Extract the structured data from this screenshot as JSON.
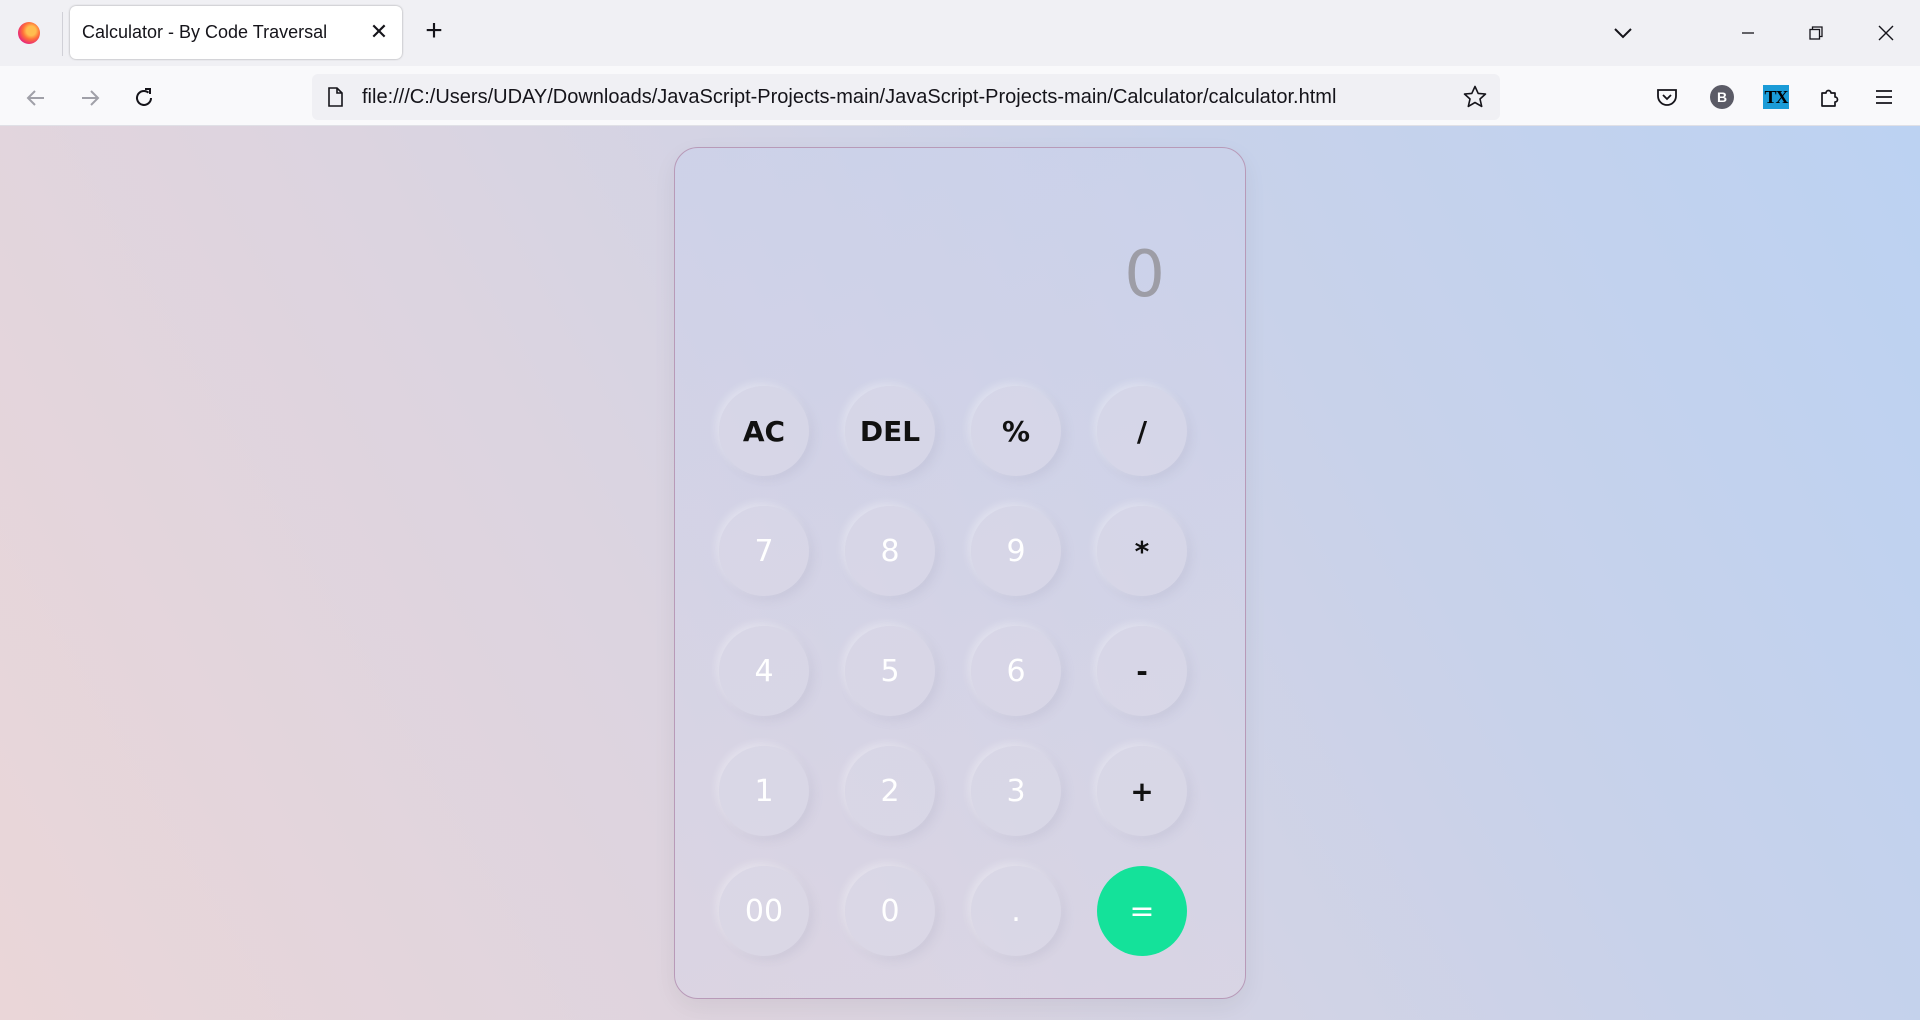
{
  "browser": {
    "tab_title": "Calculator - By Code Traversal",
    "url": "file:///C:/Users/UDAY/Downloads/JavaScript-Projects-main/JavaScript-Projects-main/Calculator/calculator.html",
    "profile_initial": "B",
    "extension_label": "TX"
  },
  "calculator": {
    "display": "0",
    "buttons": [
      {
        "label": "AC",
        "kind": "op"
      },
      {
        "label": "DEL",
        "kind": "op"
      },
      {
        "label": "%",
        "kind": "op"
      },
      {
        "label": "/",
        "kind": "op"
      },
      {
        "label": "7",
        "kind": "num"
      },
      {
        "label": "8",
        "kind": "num"
      },
      {
        "label": "9",
        "kind": "num"
      },
      {
        "label": "*",
        "kind": "op"
      },
      {
        "label": "4",
        "kind": "num"
      },
      {
        "label": "5",
        "kind": "num"
      },
      {
        "label": "6",
        "kind": "num"
      },
      {
        "label": "-",
        "kind": "op"
      },
      {
        "label": "1",
        "kind": "num"
      },
      {
        "label": "2",
        "kind": "num"
      },
      {
        "label": "3",
        "kind": "num"
      },
      {
        "label": "+",
        "kind": "op"
      },
      {
        "label": "00",
        "kind": "num"
      },
      {
        "label": "0",
        "kind": "num"
      },
      {
        "label": ".",
        "kind": "num"
      },
      {
        "label": "=",
        "kind": "equals"
      }
    ],
    "equals_color": "#14e29a"
  }
}
